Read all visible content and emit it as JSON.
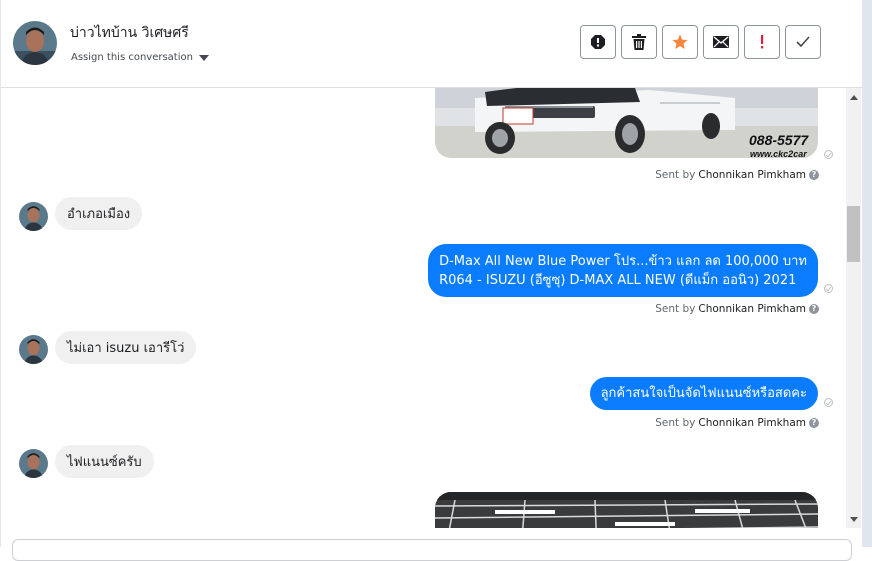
{
  "header": {
    "contact_name": "บ่าวไทบ้าน วิเศษศรี",
    "assign_label": "Assign this conversation",
    "actions": [
      {
        "name": "spam-icon",
        "color": "#1c1e21"
      },
      {
        "name": "trash-icon",
        "color": "#1c1e21"
      },
      {
        "name": "star-icon",
        "color": "#f5853f"
      },
      {
        "name": "mail-icon",
        "color": "#1c1e21"
      },
      {
        "name": "important-icon",
        "color": "#e41e3f"
      },
      {
        "name": "check-icon",
        "color": "#444950"
      }
    ]
  },
  "image_watermark": {
    "phone": "088-5577",
    "site": "www.ckc2car"
  },
  "messages": [
    {
      "direction": "in",
      "text": "อำเภอเมือง"
    },
    {
      "direction": "out",
      "lines": [
        "D-Max All New Blue Power โปร...ข้าว แลก ลด 100,000 บาท",
        "R064 - ISUZU (อีซูซุ) D-MAX ALL NEW (ดีแม็ก ออนิว) 2021"
      ]
    },
    {
      "direction": "in",
      "text": "ไม่เอา isuzu เอารีโว่"
    },
    {
      "direction": "out",
      "lines": [
        "ลูกค้าสนใจเป็นจัดไฟแนนซ์หรือสดคะ"
      ]
    },
    {
      "direction": "in",
      "text": "ไฟแนนซ์ครับ"
    }
  ],
  "sent_by": {
    "prefix": "Sent by",
    "agent": "Chonnikan Pimkham",
    "help": "?"
  },
  "colors": {
    "outgoing_bubble": "#0a7cff",
    "incoming_bubble": "#f0f0f0"
  }
}
